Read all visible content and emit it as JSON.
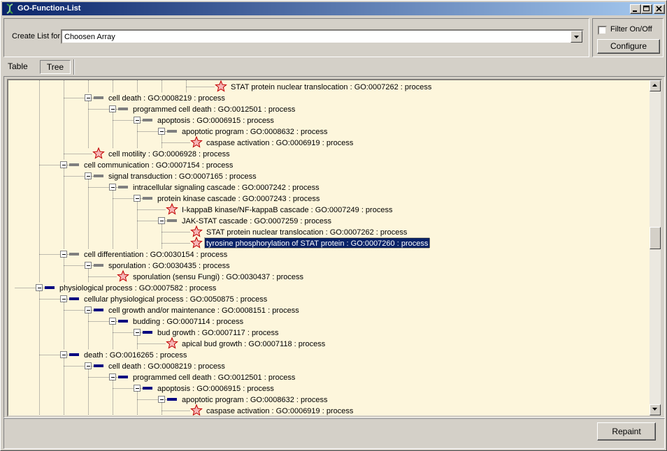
{
  "window": {
    "title": "GO-Function-List",
    "controls": [
      "minimize",
      "maximize",
      "close"
    ]
  },
  "toolbar": {
    "create_label": "Create List for",
    "array_value": "Choosen Array",
    "filter_label": "Filter On/Off",
    "filter_checked": false,
    "configure_label": "Configure"
  },
  "tabs": [
    {
      "label": "Table",
      "selected": false
    },
    {
      "label": "Tree",
      "selected": true
    }
  ],
  "tree": {
    "rows": [
      {
        "level": 8,
        "leaf": true,
        "text": "STAT protein nuclear translocation : GO:0007262 : process",
        "color": "gray"
      },
      {
        "level": 3,
        "leaf": false,
        "text": "cell death : GO:0008219 : process",
        "color": "gray"
      },
      {
        "level": 4,
        "leaf": false,
        "text": "programmed cell death : GO:0012501 : process",
        "color": "gray"
      },
      {
        "level": 5,
        "leaf": false,
        "text": "apoptosis : GO:0006915 : process",
        "color": "gray"
      },
      {
        "level": 6,
        "leaf": false,
        "text": "apoptotic program : GO:0008632 : process",
        "color": "gray"
      },
      {
        "level": 7,
        "leaf": true,
        "text": "caspase activation : GO:0006919 : process",
        "color": "gray"
      },
      {
        "level": 3,
        "leaf": true,
        "text": "cell motility : GO:0006928 : process",
        "color": "gray"
      },
      {
        "level": 2,
        "leaf": false,
        "text": "cell communication : GO:0007154 : process",
        "color": "gray"
      },
      {
        "level": 3,
        "leaf": false,
        "text": "signal transduction : GO:0007165 : process",
        "color": "gray"
      },
      {
        "level": 4,
        "leaf": false,
        "text": "intracellular signaling cascade : GO:0007242 : process",
        "color": "gray"
      },
      {
        "level": 5,
        "leaf": false,
        "text": "protein kinase cascade : GO:0007243 : process",
        "color": "gray"
      },
      {
        "level": 6,
        "leaf": true,
        "text": "I-kappaB kinase/NF-kappaB cascade : GO:0007249 : process",
        "color": "gray"
      },
      {
        "level": 6,
        "leaf": false,
        "text": "JAK-STAT cascade : GO:0007259 : process",
        "color": "gray"
      },
      {
        "level": 7,
        "leaf": true,
        "text": "STAT protein nuclear translocation : GO:0007262 : process",
        "color": "gray"
      },
      {
        "level": 7,
        "leaf": true,
        "text": "tyrosine phosphorylation of STAT protein : GO:0007260 : process",
        "color": "gray",
        "selected": true
      },
      {
        "level": 2,
        "leaf": false,
        "text": "cell differentiation : GO:0030154 : process",
        "color": "gray"
      },
      {
        "level": 3,
        "leaf": false,
        "text": "sporulation : GO:0030435 : process",
        "color": "gray"
      },
      {
        "level": 4,
        "leaf": true,
        "text": "sporulation (sensu Fungi) : GO:0030437 : process",
        "color": "gray"
      },
      {
        "level": 1,
        "leaf": false,
        "text": "physiological process : GO:0007582 : process",
        "color": "navy"
      },
      {
        "level": 2,
        "leaf": false,
        "text": "cellular physiological process : GO:0050875 : process",
        "color": "navy"
      },
      {
        "level": 3,
        "leaf": false,
        "text": "cell growth and/or maintenance : GO:0008151 : process",
        "color": "navy"
      },
      {
        "level": 4,
        "leaf": false,
        "text": "budding : GO:0007114 : process",
        "color": "navy"
      },
      {
        "level": 5,
        "leaf": false,
        "text": "bud growth : GO:0007117 : process",
        "color": "navy"
      },
      {
        "level": 6,
        "leaf": true,
        "text": "apical bud growth : GO:0007118 : process",
        "color": "navy"
      },
      {
        "level": 2,
        "leaf": false,
        "text": "death : GO:0016265 : process",
        "color": "navy"
      },
      {
        "level": 3,
        "leaf": false,
        "text": "cell death : GO:0008219 : process",
        "color": "navy"
      },
      {
        "level": 4,
        "leaf": false,
        "text": "programmed cell death : GO:0012501 : process",
        "color": "navy"
      },
      {
        "level": 5,
        "leaf": false,
        "text": "apoptosis : GO:0006915 : process",
        "color": "navy"
      },
      {
        "level": 6,
        "leaf": false,
        "text": "apoptotic program : GO:0008632 : process",
        "color": "navy"
      },
      {
        "level": 7,
        "leaf": true,
        "text": "caspase activation : GO:0006919 : process",
        "color": "navy"
      }
    ]
  },
  "footer": {
    "repaint_label": "Repaint"
  },
  "colors": {
    "tree_background": "#fdf6dc",
    "selection": "#0a246a",
    "gray_bar": "#7f7f7f",
    "navy_bar": "#000080",
    "star_fill": "#f6b6b6",
    "star_stroke": "#c00000"
  }
}
